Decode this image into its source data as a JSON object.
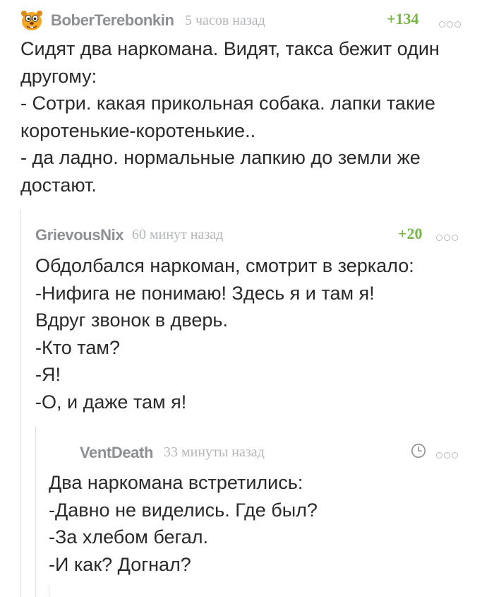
{
  "comments": [
    {
      "author": "BoberTerebonkin",
      "time": "5 часов назад",
      "rating": "+134",
      "avatar_icon": "beaver-avatar-icon",
      "lines": [
        "Сидят два наркомана. Видят, такса бежит один",
        "другому:",
        "- Сотри. какая прикольная собака. лапки такие",
        "коротенькие-коротенькие..",
        "- да ладно. нормальные лапкию до земли же",
        "достают."
      ]
    },
    {
      "author": "GrievousNix",
      "time": "60 минут назад",
      "rating": "+20",
      "lines": [
        "Обдолбался наркоман, смотрит в зеркало:",
        "-Нифига не понимаю! Здесь я и там я!",
        "Вдруг звонок в дверь.",
        "-Кто там?",
        "-Я!",
        "-О, и даже там я!"
      ]
    },
    {
      "author": "VentDeath",
      "time": "33 минуты назад",
      "rating_icon": "clock-icon",
      "lines": [
        "Два наркомана встретились:",
        "-Давно не виделись. Где был?",
        "-За хлебом бегал.",
        "-И как? Догнал?"
      ]
    }
  ],
  "colors": {
    "author": "#8c8f94",
    "time": "#b3b6ba",
    "rating_positive": "#74b843",
    "text": "#2a2a2a",
    "thread_line": "#dfe1e4"
  }
}
